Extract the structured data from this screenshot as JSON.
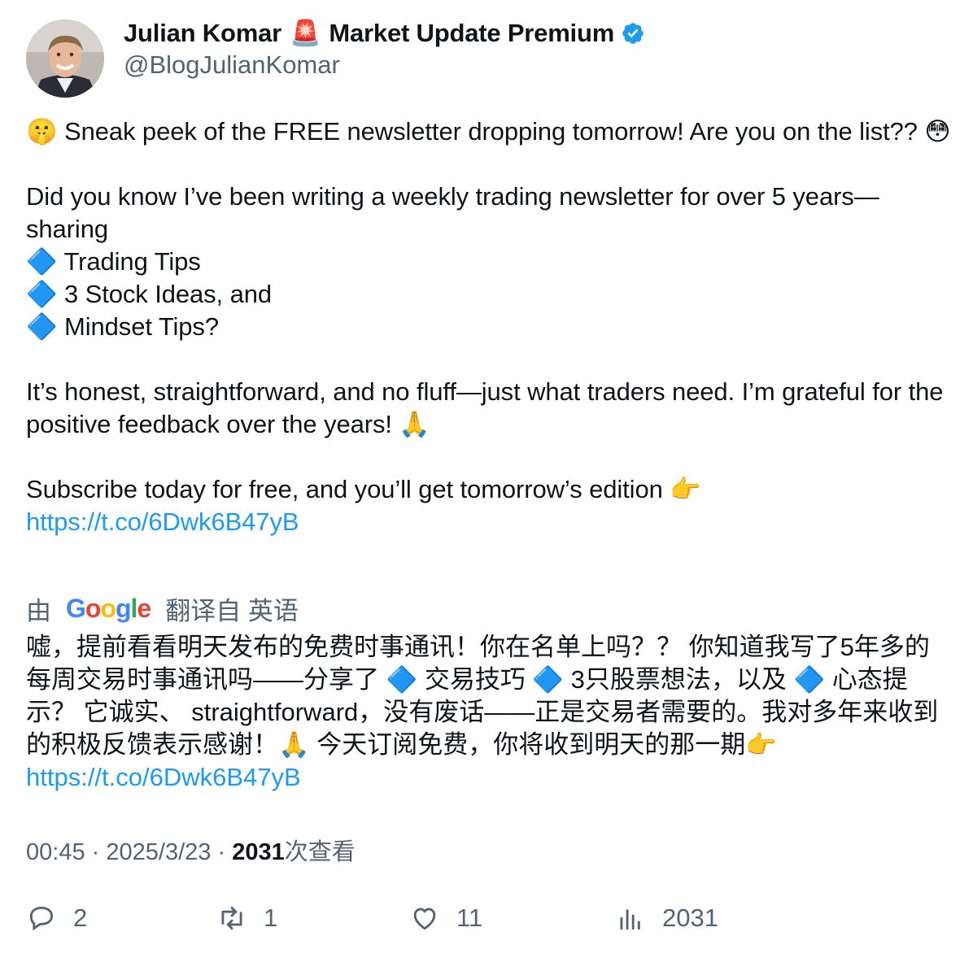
{
  "author": {
    "name": "Julian Komar",
    "badge_emoji": "🚨",
    "title_suffix": "Market Update Premium",
    "handle": "@BlogJulianKomar",
    "verified_icon": "verified-badge-icon",
    "verified_color": "#1d9bf0"
  },
  "tweet": {
    "line1": "🤫 Sneak peek of the FREE newsletter dropping tomorrow! Are you on the list?? 😳",
    "line2": "Did you know I’ve been writing a weekly trading newsletter for over 5 years—sharing",
    "bullet_icon": "🔷",
    "bullets": [
      "Trading Tips",
      "3 Stock Ideas, and",
      "Mindset Tips?"
    ],
    "line3": "It’s honest, straightforward, and no fluff—just what traders need. I’m grateful for the positive feedback over the years! 🙏",
    "line4": "Subscribe today for free, and you’ll get tomorrow’s edition 👉",
    "link": "https://t.co/6Dwk6B47yB"
  },
  "translation": {
    "prefix": "由",
    "provider": "Google",
    "suffix": "翻译自 英语",
    "text": "嘘，提前看看明天发布的免费时事通讯！你在名单上吗？？ 你知道我写了5年多的每周交易时事通讯吗——分享了 🔷 交易技巧 🔷 3只股票想法，以及 🔷 心态提示？ 它诚实、 straightforward，没有废话——正是交易者需要的。我对多年来收到的积极反馈表示感谢！🙏 今天订阅免费，你将收到明天的那一期👉",
    "link": "https://t.co/6Dwk6B47yB"
  },
  "meta": {
    "time": "00:45",
    "sep": "·",
    "date": "2025/3/23",
    "views_count": "2031",
    "views_label": "次查看"
  },
  "actions": {
    "replies": "2",
    "retweets": "1",
    "likes": "11",
    "views": "2031"
  },
  "colors": {
    "text": "#0f1419",
    "secondary": "#536471",
    "link": "#1d9bf0"
  }
}
